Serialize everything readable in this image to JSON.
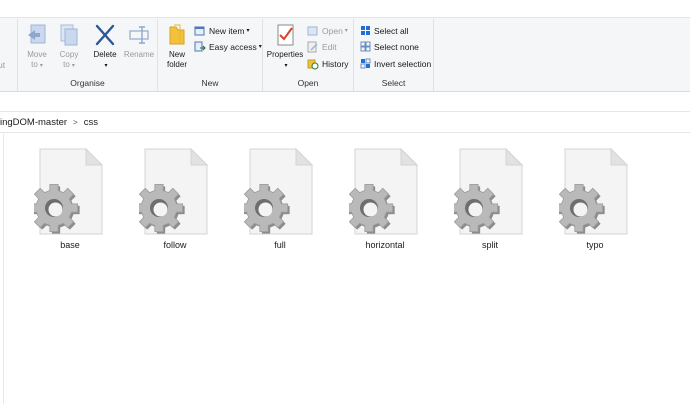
{
  "ribbon": {
    "clipboard_fragment": "ut",
    "organise": {
      "label": "Organise",
      "move_to": [
        "Move",
        "to"
      ],
      "copy_to": [
        "Copy",
        "to"
      ],
      "delete": "Delete",
      "rename": "Rename"
    },
    "new": {
      "label": "New",
      "new_folder": [
        "New",
        "folder"
      ],
      "new_item": "New item",
      "easy_access": "Easy access"
    },
    "open": {
      "label": "Open",
      "properties": "Properties",
      "open": "Open",
      "edit": "Edit",
      "history": "History"
    },
    "select": {
      "label": "Select",
      "select_all": "Select all",
      "select_none": "Select none",
      "invert_selection": "Invert selection"
    }
  },
  "address": {
    "crumbs": [
      "ingDOM-master",
      "css"
    ]
  },
  "files": [
    {
      "name": "base"
    },
    {
      "name": "follow"
    },
    {
      "name": "full"
    },
    {
      "name": "horizontal"
    },
    {
      "name": "split"
    },
    {
      "name": "typo"
    }
  ],
  "colors": {
    "ribbon_bg": "#f5f6f7",
    "accent_blue": "#1e6fd9",
    "delete_blue": "#2b5797",
    "properties_red": "#d9432a",
    "folder_yellow": "#f3c13a"
  }
}
